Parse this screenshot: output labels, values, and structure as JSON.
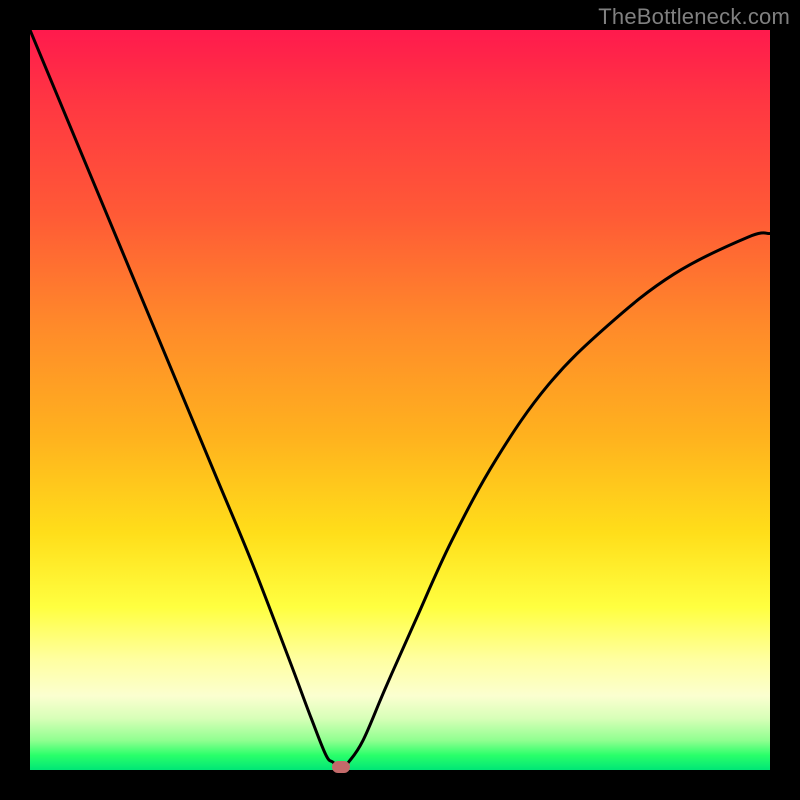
{
  "watermark": "TheBottleneck.com",
  "colors": {
    "frame": "#000000",
    "curve": "#000000",
    "marker": "#c46a6a",
    "gradient_stops": [
      "#ff1a4d",
      "#ff3742",
      "#ff5a36",
      "#ff8a2a",
      "#ffb21e",
      "#ffde1a",
      "#ffff40",
      "#ffffa0",
      "#fbffd0",
      "#d8ffb8",
      "#90ff90",
      "#2aff6a",
      "#00e676"
    ]
  },
  "chart_data": {
    "type": "line",
    "title": "",
    "xlabel": "",
    "ylabel": "",
    "xlim": [
      0,
      100
    ],
    "ylim": [
      0,
      100
    ],
    "grid": false,
    "legend": false,
    "x": [
      0,
      5,
      10,
      15,
      20,
      25,
      30,
      35,
      38,
      40,
      41,
      42,
      43,
      45,
      48,
      52,
      57,
      63,
      70,
      78,
      87,
      97,
      100
    ],
    "y": [
      100,
      88,
      76,
      64,
      52,
      40,
      28,
      15,
      7,
      2,
      1,
      0,
      1,
      4,
      11,
      20,
      31,
      42,
      52,
      60,
      67,
      72,
      72.5
    ],
    "minimum_marker": {
      "x": 42,
      "y": 0
    }
  }
}
